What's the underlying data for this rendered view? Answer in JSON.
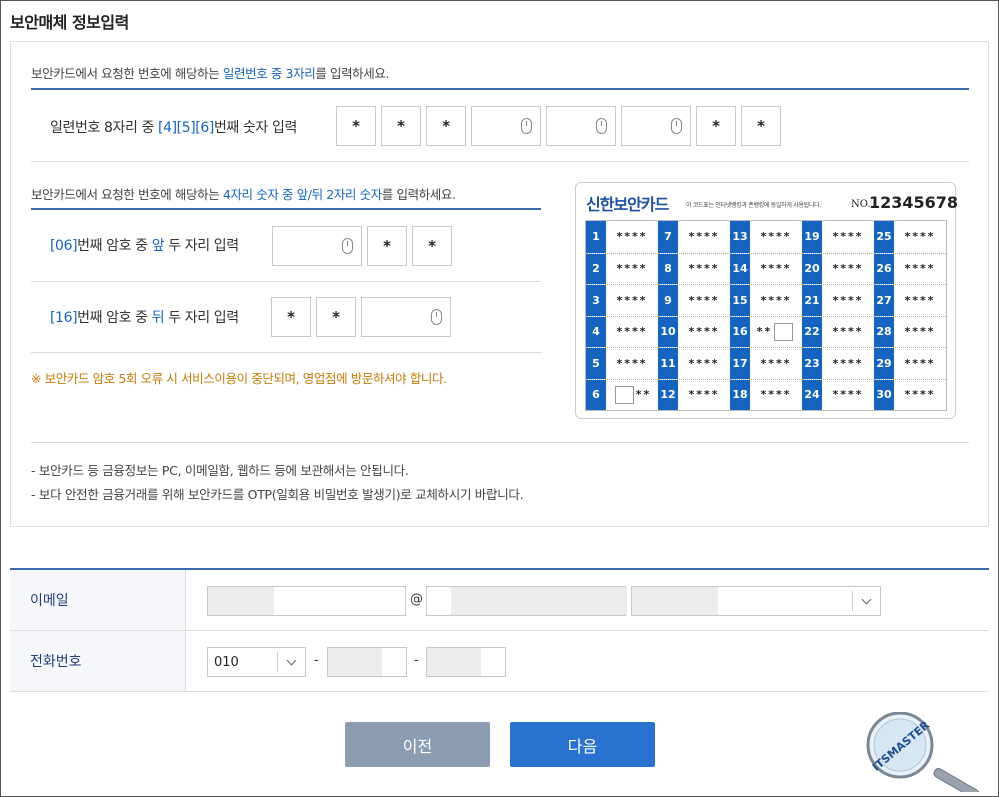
{
  "title": "보안매체 정보입력",
  "section1": {
    "instruction_pre": "보안카드에서 요청한 번호에 해당하는 ",
    "instruction_hl": "일련번호 중 3자리",
    "instruction_post": "를 입력하세요.",
    "label_pre": "일련번호 8자리 중 ",
    "label_hl": "[4][5][6]",
    "label_post": "번째 숫자 입력",
    "cells": [
      "*",
      "*",
      "*",
      "",
      "",
      "",
      "*",
      "*"
    ]
  },
  "section2": {
    "instruction_pre": "보안카드에서 요청한 번호에 해당하는 ",
    "instruction_hl": "4자리 숫자 중 앞/뒤 2자리 숫자",
    "instruction_post": "를 입력하세요.",
    "row1": {
      "num": "[06]",
      "mid": "번째 암호 중 ",
      "pos": "앞",
      "post": " 두 자리 입력",
      "cells": [
        "",
        "*",
        "*"
      ]
    },
    "row2": {
      "num": "[16]",
      "mid": "번째 암호 중 ",
      "pos": "뒤",
      "post": " 두 자리 입력",
      "cells": [
        "*",
        "*",
        ""
      ]
    },
    "warning": "※ 보안카드 암호 5회 오류 시 서비스이용이 중단되며, 영업점에 방문하셔야 합니다."
  },
  "card": {
    "title": "신한보안카드",
    "note": "이 코드표는 인터넷뱅킹과 폰뱅킹에 동일하게 사용됩니다.",
    "no_label": "NO.",
    "no": "12345678",
    "stars": "****",
    "partial": "**"
  },
  "notes": [
    "-  보안카드 등 금융정보는 PC, 이메일함, 웹하드 등에 보관해서는 안됩니다.",
    "-  보다 안전한 금융거래를 위해 보안카드를 OTP(일회용 비밀번호 발생기)로 교체하시기 바랍니다."
  ],
  "form": {
    "email_label": "이메일",
    "at": "@",
    "phone_label": "전화번호",
    "phone_prefix": "010",
    "dash": "-"
  },
  "buttons": {
    "prev": "이전",
    "next": "다음"
  },
  "logo_text": "ITSMASTER",
  "colors": {
    "accent": "#1565c0",
    "warning": "#c47c08",
    "next_button": "#2a72d0",
    "prev_button": "#8c9cb1"
  }
}
